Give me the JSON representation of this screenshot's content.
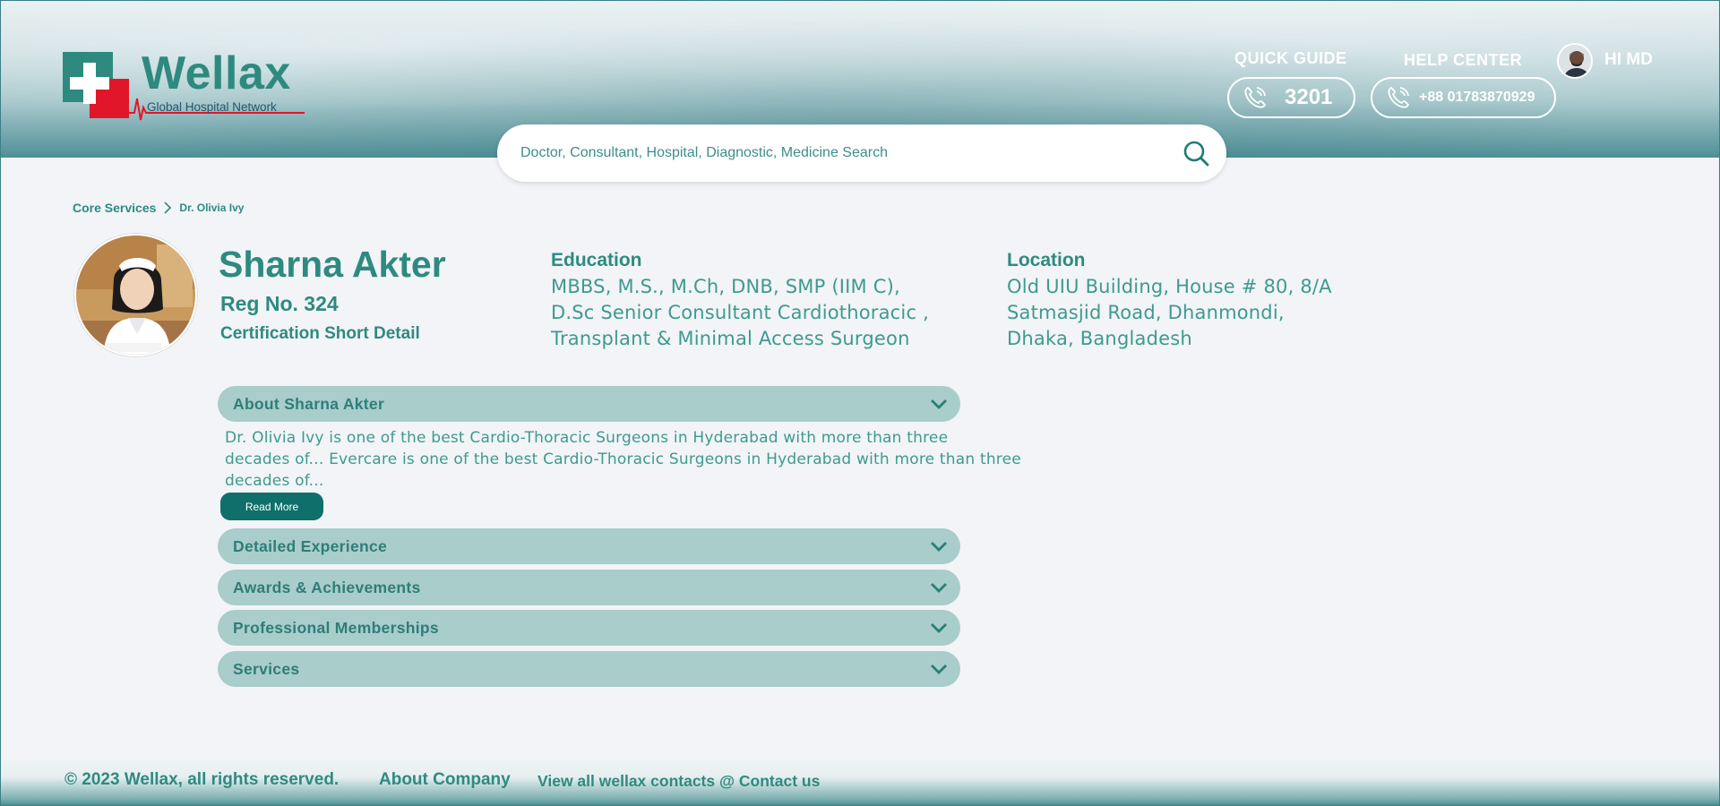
{
  "header": {
    "logo": {
      "name": "Wellax",
      "tagline": "Global Hospital Network"
    },
    "quick_guide": {
      "label": "QUICK GUIDE",
      "number": "3201"
    },
    "help_center": {
      "label": "HELP CENTER",
      "number": "+88 01783870929"
    },
    "user": {
      "greeting": "HI MD"
    },
    "search": {
      "placeholder": "Doctor, Consultant, Hospital, Diagnostic, Medicine Search",
      "value": ""
    }
  },
  "breadcrumb": [
    "Core Services",
    "Dr. Olivia Ivy"
  ],
  "doctor": {
    "name": "Sharna Akter",
    "reg_no": "Reg No. 324",
    "certification": "Certification Short Detail",
    "education_title": "Education",
    "education_lines": [
      "MBBS, M.S., M.Ch, DNB, SMP (IIM C),",
      "D.Sc Senior Consultant Cardiothoracic ,",
      "Transplant & Minimal Access Surgeon"
    ],
    "location_title": "Location",
    "location_lines": [
      "Old UIU Building, House # 80, 8/A",
      "Satmasjid Road, Dhanmondi,",
      "Dhaka, Bangladesh"
    ]
  },
  "accordions": [
    {
      "label": "About Sharna Akter",
      "expanded": true
    },
    {
      "label": "Detailed Experience",
      "expanded": false
    },
    {
      "label": "Awards & Achievements",
      "expanded": false
    },
    {
      "label": "Professional Memberships",
      "expanded": false
    },
    {
      "label": "Services",
      "expanded": false
    }
  ],
  "about": {
    "lines": [
      "Dr. Olivia Ivy is one of the best Cardio-Thoracic Surgeons in Hyderabad with more than three",
      "decades of... Evercare is one of the best Cardio-Thoracic Surgeons in Hyderabad with more than three",
      "decades of..."
    ],
    "read_more": "Read More"
  },
  "footer": {
    "copyright": "© 2023 Wellax, all rights reserved.",
    "about": "About Company",
    "contact": "View all wellax contacts @ Contact us"
  },
  "colors": {
    "primary": "#2e8a80",
    "accordion": "#a8cdcb",
    "button": "#0f6f6a",
    "logo_red": "#e2162b"
  }
}
